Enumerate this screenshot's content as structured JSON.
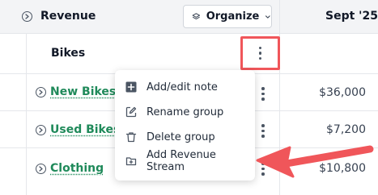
{
  "header": {
    "section_title": "Revenue",
    "organize_label": "Organize",
    "month_label": "Sept '25"
  },
  "group": {
    "name": "Bikes"
  },
  "rows": [
    {
      "name": "New Bikes",
      "value": "$36,000"
    },
    {
      "name": "Used Bikes",
      "value": "$7,200"
    },
    {
      "name": "Clothing",
      "value": "$10,800"
    }
  ],
  "menu": {
    "items": [
      {
        "label": "Add/edit note",
        "icon": "note-plus-icon"
      },
      {
        "label": "Rename group",
        "icon": "pencil-edit-icon"
      },
      {
        "label": "Delete group",
        "icon": "trash-icon"
      },
      {
        "label": "Add Revenue Stream",
        "icon": "folder-plus-icon"
      }
    ]
  },
  "colors": {
    "link_green": "#1f8a5a",
    "highlight_red": "#f0565a",
    "header_bg": "#f3f4f6"
  }
}
